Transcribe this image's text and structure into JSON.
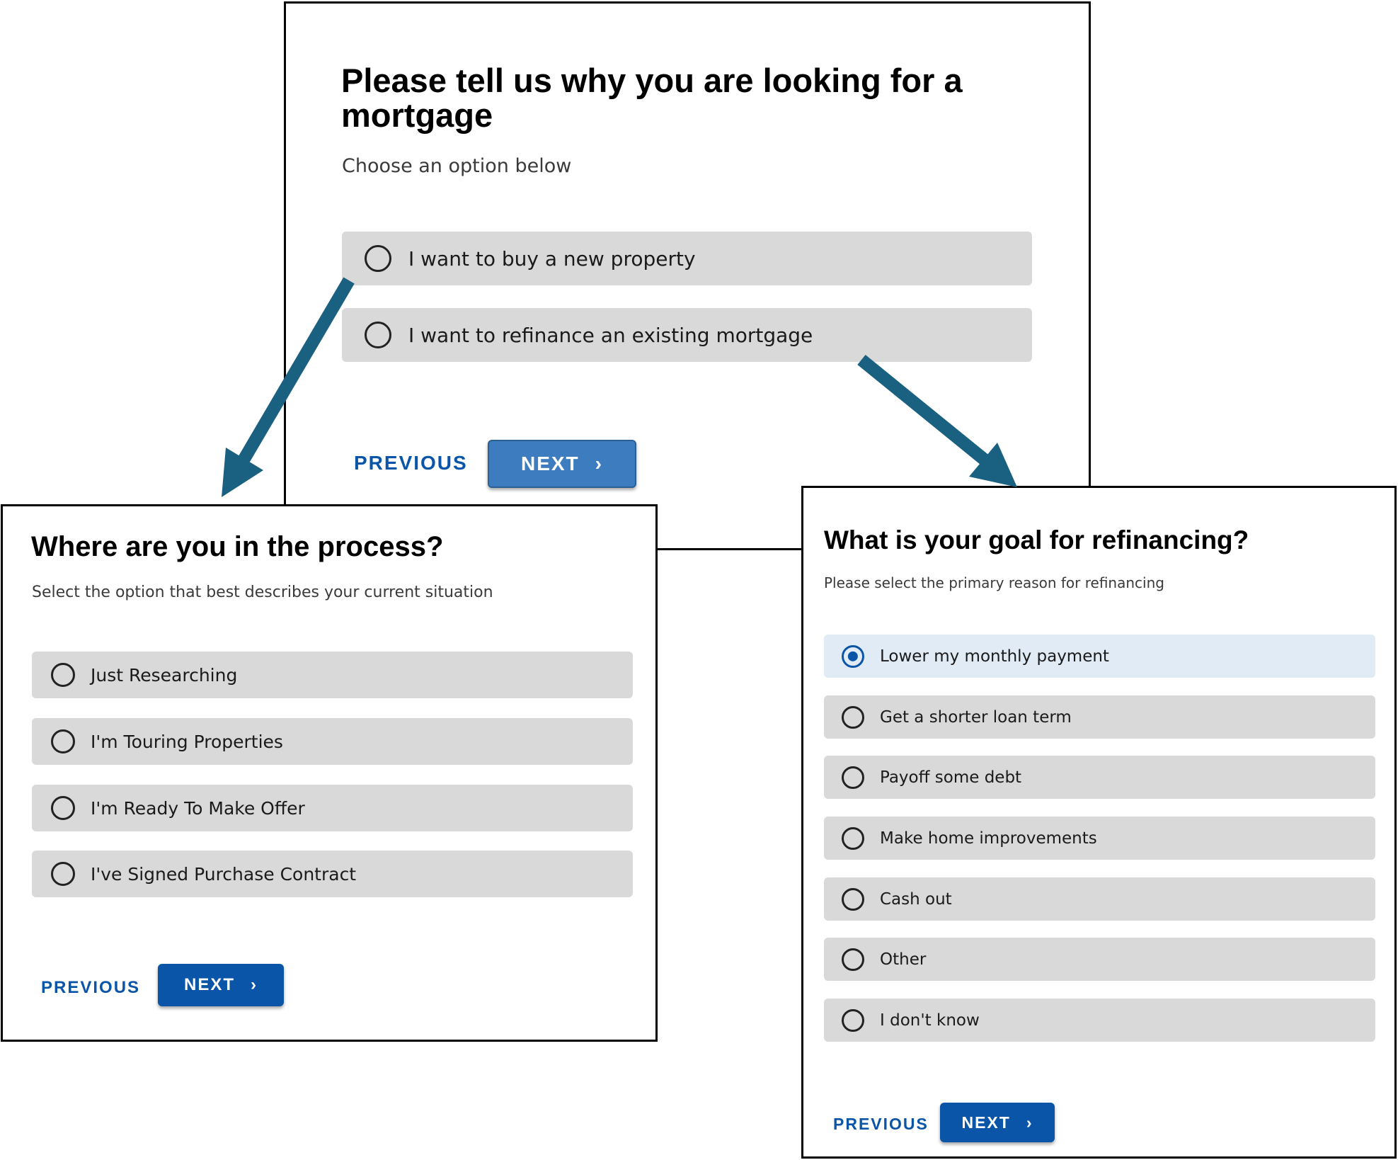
{
  "colors": {
    "accent": "#0a55a8",
    "accent_light": "#3d7dbf",
    "option_bg": "#d9d9d9",
    "option_selected_bg": "#e1ebf5",
    "arrow": "#1a6080",
    "panel_border": "#000000"
  },
  "top_panel": {
    "title": "Please tell us why you are looking for a mortgage",
    "subtitle": "Choose an option below",
    "options": [
      {
        "label": "I want to buy a new property",
        "selected": false
      },
      {
        "label": "I want to refinance an existing mortgage",
        "selected": false
      }
    ],
    "previous_label": "PREVIOUS",
    "next_label": "NEXT",
    "next_icon": "chevron-right-icon"
  },
  "left_panel": {
    "title": "Where are you in the process?",
    "subtitle": "Select the option that best describes your current situation",
    "options": [
      {
        "label": "Just Researching",
        "selected": false
      },
      {
        "label": "I'm Touring Properties",
        "selected": false
      },
      {
        "label": "I'm Ready To Make Offer",
        "selected": false
      },
      {
        "label": "I've Signed Purchase Contract",
        "selected": false
      }
    ],
    "previous_label": "PREVIOUS",
    "next_label": "NEXT",
    "next_icon": "chevron-right-icon"
  },
  "right_panel": {
    "title": "What is your goal for refinancing?",
    "subtitle": "Please select the primary reason for refinancing",
    "options": [
      {
        "label": "Lower my monthly payment",
        "selected": true
      },
      {
        "label": "Get a shorter loan term",
        "selected": false
      },
      {
        "label": "Payoff some debt",
        "selected": false
      },
      {
        "label": "Make home improvements",
        "selected": false
      },
      {
        "label": "Cash out",
        "selected": false
      },
      {
        "label": "Other",
        "selected": false
      },
      {
        "label": "I don't know",
        "selected": false
      }
    ],
    "previous_label": "PREVIOUS",
    "next_label": "NEXT",
    "next_icon": "chevron-right-icon"
  },
  "flow_arrows": [
    {
      "from": "I want to buy a new property",
      "to": "Where are you in the process?"
    },
    {
      "from": "I want to refinance an existing mortgage",
      "to": "What is your goal for refinancing?"
    }
  ],
  "chevron_glyph": "›"
}
